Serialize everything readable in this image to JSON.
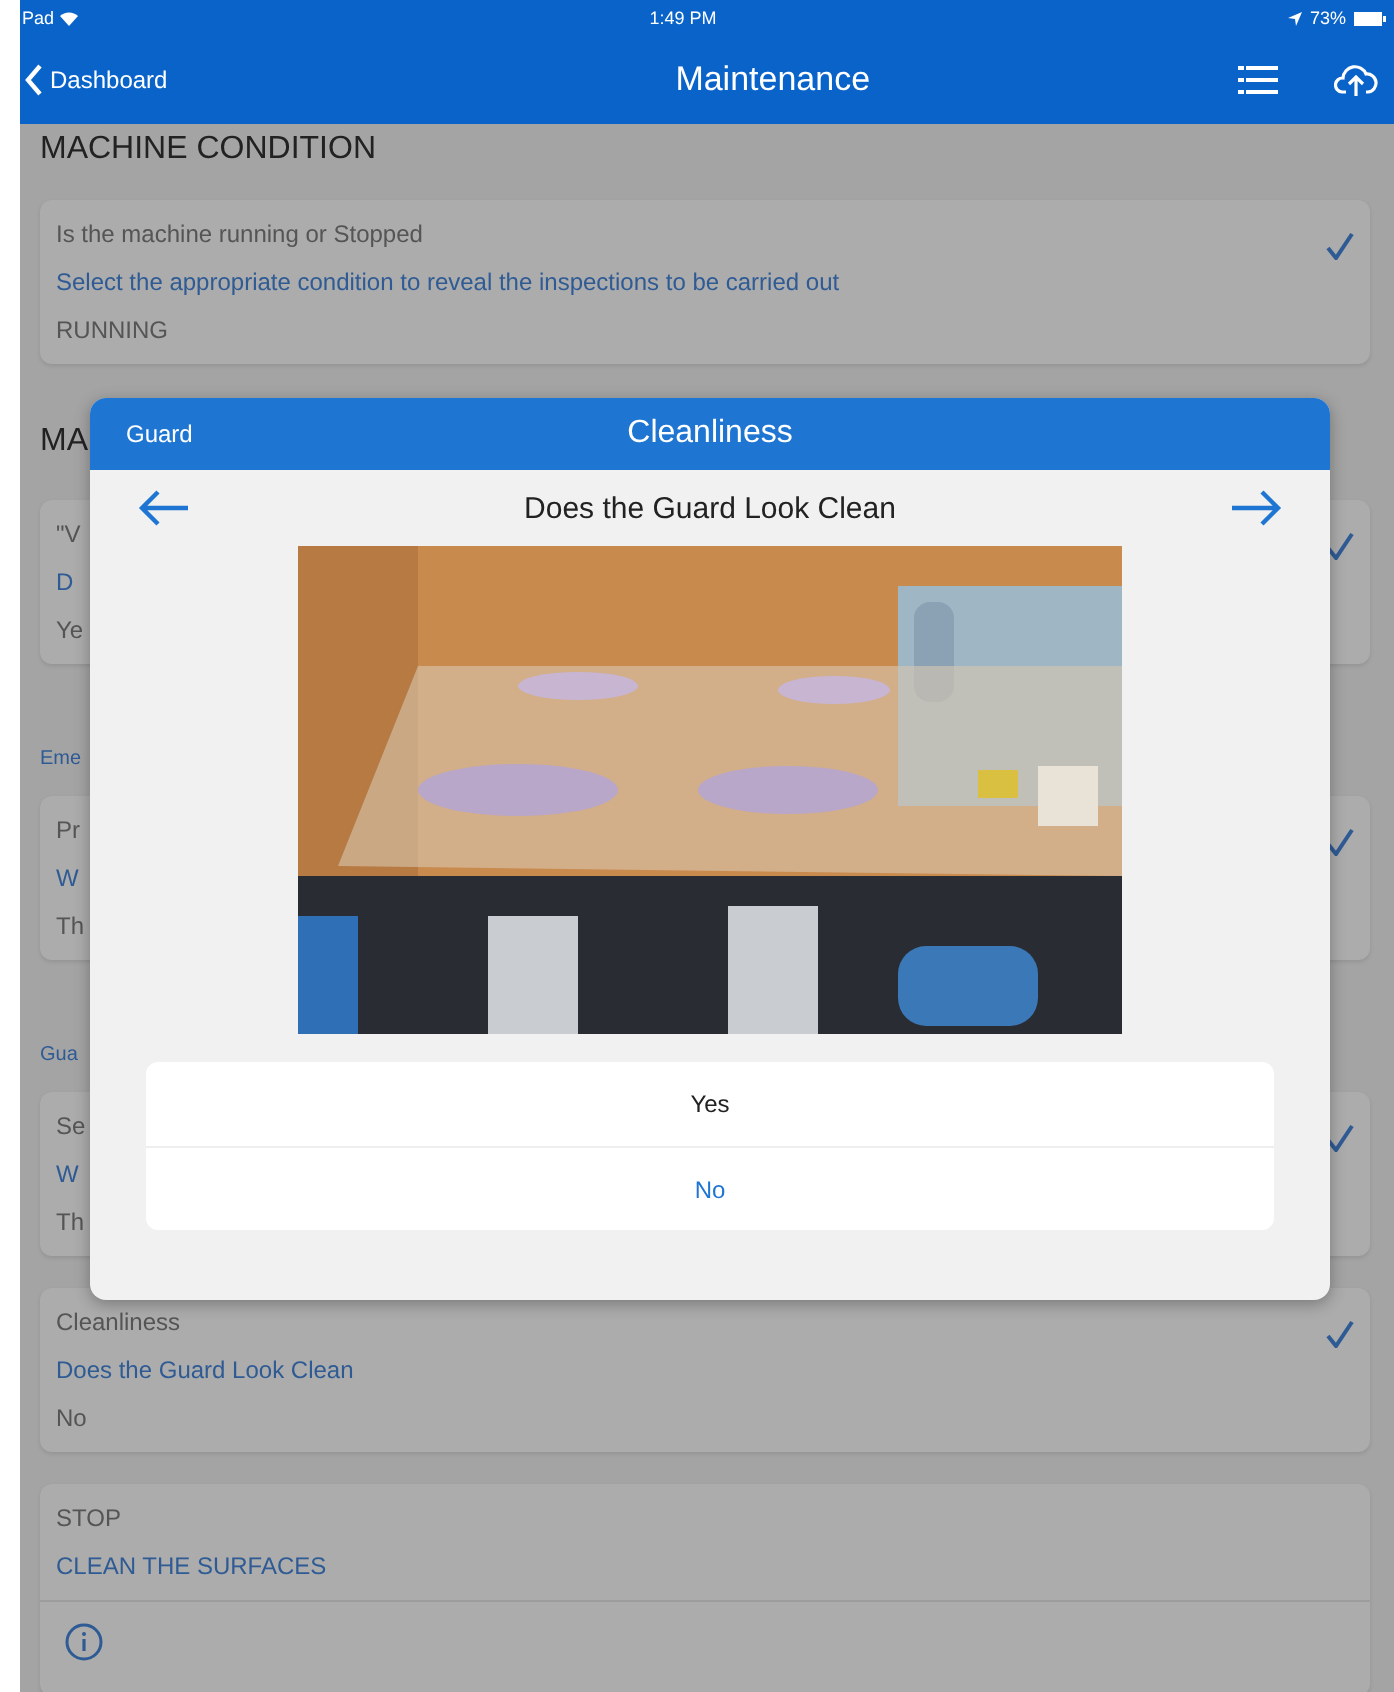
{
  "status_bar": {
    "device": "Pad",
    "time": "1:49 PM",
    "battery": "73%"
  },
  "nav": {
    "back": "Dashboard",
    "title": "Maintenance"
  },
  "items": [
    {
      "kind": "heading",
      "text": "MACHINE CONDITION"
    },
    {
      "kind": "card",
      "label": "Is the machine running or Stopped",
      "question": "Select the appropriate condition to reveal the inspections to be carried out",
      "answer": "RUNNING",
      "checked": true
    },
    {
      "kind": "heading",
      "text": "MA"
    },
    {
      "kind": "card",
      "label": "\"V",
      "question": "D",
      "answer": "Ye",
      "checked": true
    },
    {
      "kind": "subheading",
      "text": "Eme"
    },
    {
      "kind": "card",
      "label": "Pr",
      "question": "W",
      "answer": "Th",
      "checked": true
    },
    {
      "kind": "subheading",
      "text": "Gua"
    },
    {
      "kind": "card",
      "label": "Se",
      "question": "W",
      "answer": "Th",
      "checked": true
    },
    {
      "kind": "card",
      "label": "Cleanliness",
      "question": "Does the Guard Look Clean",
      "answer": "No",
      "checked": true
    },
    {
      "kind": "action",
      "label": "STOP",
      "question": "CLEAN THE SURFACES",
      "checked": false
    }
  ],
  "modal": {
    "category": "Guard",
    "title": "Cleanliness",
    "question": "Does the Guard Look Clean",
    "options": [
      {
        "label": "Yes",
        "selected": false
      },
      {
        "label": "No",
        "selected": true
      }
    ]
  }
}
